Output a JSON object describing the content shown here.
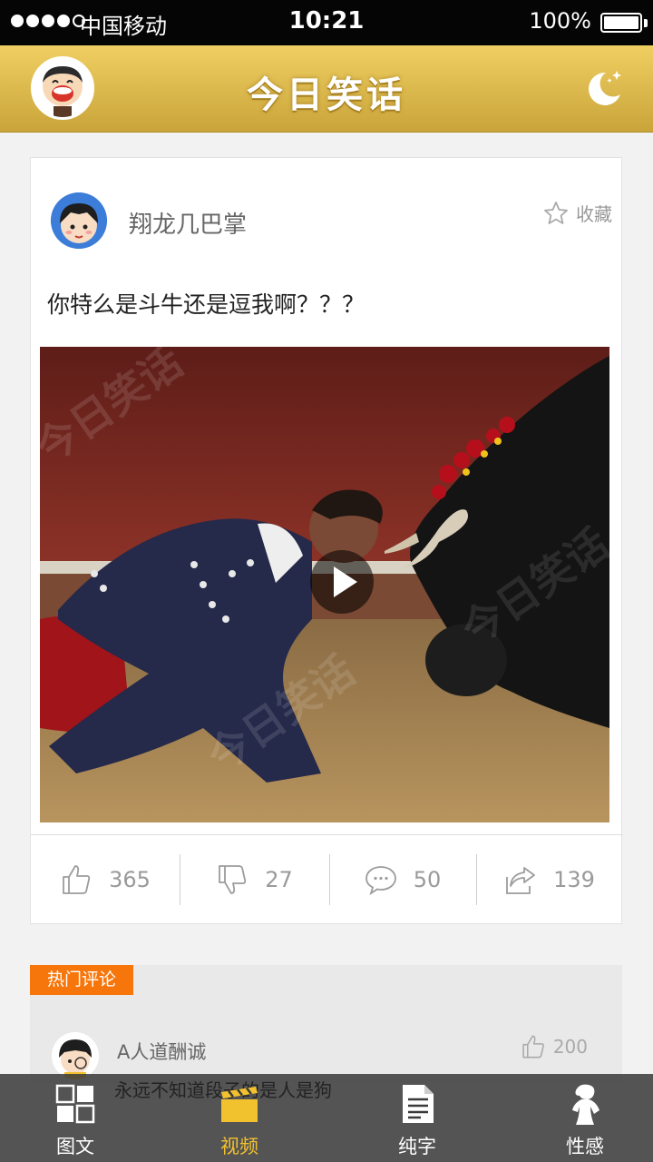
{
  "status_bar": {
    "carrier": "中国移动",
    "time": "10:21",
    "battery": "100%"
  },
  "header": {
    "title": "今日笑话",
    "avatar_icon": "cartoon-avatar-icon",
    "night_mode_icon": "moon-icon"
  },
  "post": {
    "author": "翔龙几巴掌",
    "favorite_label": "收藏",
    "text": "你特么是斗牛还是逗我啊？？？",
    "media_type": "video",
    "actions": [
      {
        "icon": "thumbs-up-icon",
        "count": "365"
      },
      {
        "icon": "thumbs-down-icon",
        "count": "27"
      },
      {
        "icon": "comment-icon",
        "count": "50"
      },
      {
        "icon": "share-icon",
        "count": "139"
      }
    ]
  },
  "hot_comments": {
    "tag": "热门评论",
    "items": [
      {
        "user": "A人道酬诚",
        "likes": "200",
        "text": "永远不知道段子的是人是狗"
      }
    ]
  },
  "tabbar": {
    "active": "视频",
    "tabs": [
      {
        "label": "图文",
        "icon": "grid-icon"
      },
      {
        "label": "视频",
        "icon": "clapperboard-icon"
      },
      {
        "label": "纯字",
        "icon": "document-icon"
      },
      {
        "label": "性感",
        "icon": "woman-silhouette-icon"
      }
    ]
  },
  "colors": {
    "header_gold": "#dcb84c",
    "hot_tag_orange": "#f6760c",
    "active_tab": "#f2c12e"
  }
}
